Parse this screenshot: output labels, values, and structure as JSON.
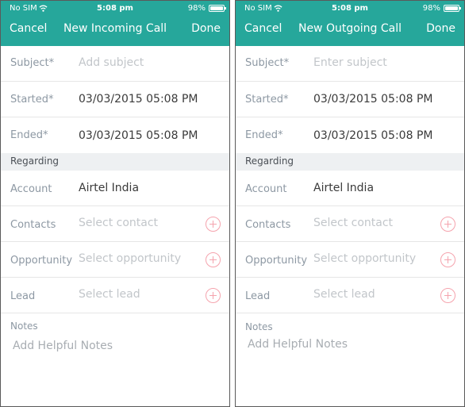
{
  "screens": [
    {
      "status": {
        "carrier": "No SIM",
        "time": "5:08 pm",
        "battery": "98%",
        "battery_level": 0.98
      },
      "nav": {
        "cancel": "Cancel",
        "title": "New Incoming Call",
        "done": "Done"
      },
      "subject": {
        "label": "Subject*",
        "placeholder": "Add subject"
      },
      "started": {
        "label": "Started*",
        "value": "03/03/2015 05:08 PM"
      },
      "ended": {
        "label": "Ended*",
        "value": "03/03/2015 05:08 PM"
      },
      "section": "Regarding",
      "account": {
        "label": "Account",
        "value": "Airtel India"
      },
      "contacts": {
        "label": "Contacts",
        "placeholder": "Select contact"
      },
      "opportunity": {
        "label": "Opportunity",
        "placeholder": "Select opportunity"
      },
      "lead": {
        "label": "Lead",
        "placeholder": "Select lead"
      },
      "notes": {
        "label": "Notes",
        "placeholder": "Add Helpful Notes"
      }
    },
    {
      "status": {
        "carrier": "No SIM",
        "time": "5:08 pm",
        "battery": "98%",
        "battery_level": 0.98
      },
      "nav": {
        "cancel": "Cancel",
        "title": "New Outgoing Call",
        "done": "Done"
      },
      "subject": {
        "label": "Subject*",
        "placeholder": "Enter subject"
      },
      "started": {
        "label": "Started*",
        "value": "03/03/2015 05:08 PM"
      },
      "ended": {
        "label": "Ended*",
        "value": "03/03/2015 05:08 PM"
      },
      "section": "Regarding",
      "account": {
        "label": "Account",
        "value": "Airtel India"
      },
      "contacts": {
        "label": "Contacts",
        "placeholder": "Select contact"
      },
      "opportunity": {
        "label": "Opportunity",
        "placeholder": "Select opportunity"
      },
      "lead": {
        "label": "Lead",
        "placeholder": "Select lead"
      },
      "notes": {
        "label": "Notes",
        "placeholder": "Add Helpful Notes"
      }
    }
  ],
  "colors": {
    "header": "#26a79b",
    "add_icon": "#f5a3ad",
    "section_bg": "#eef0f2"
  },
  "icons": {
    "wifi": "wifi-icon",
    "battery": "battery-icon",
    "add": "add-circle-icon"
  }
}
